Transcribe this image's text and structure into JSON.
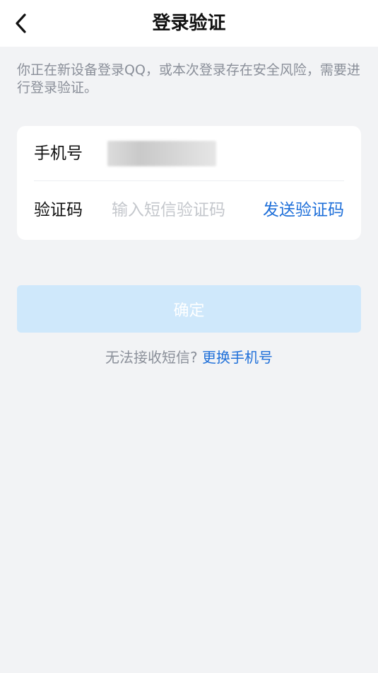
{
  "header": {
    "title": "登录验证",
    "back_icon": "chevron-left-icon"
  },
  "notice": {
    "text": "你正在新设备登录QQ，或本次登录存在安全风险，需要进行登录验证。"
  },
  "form": {
    "phone_label": "手机号",
    "phone_value_state": "blurred",
    "code_label": "验证码",
    "code_placeholder": "输入短信验证码",
    "code_value": "",
    "send_code_label": "发送验证码"
  },
  "actions": {
    "confirm_label": "确定",
    "confirm_enabled": false
  },
  "help": {
    "question": "无法接收短信?",
    "link_label": "更换手机号"
  },
  "colors": {
    "accent": "#1e6fd9",
    "disabled_button": "#cfe8fb",
    "page_background": "#f2f3f5"
  }
}
